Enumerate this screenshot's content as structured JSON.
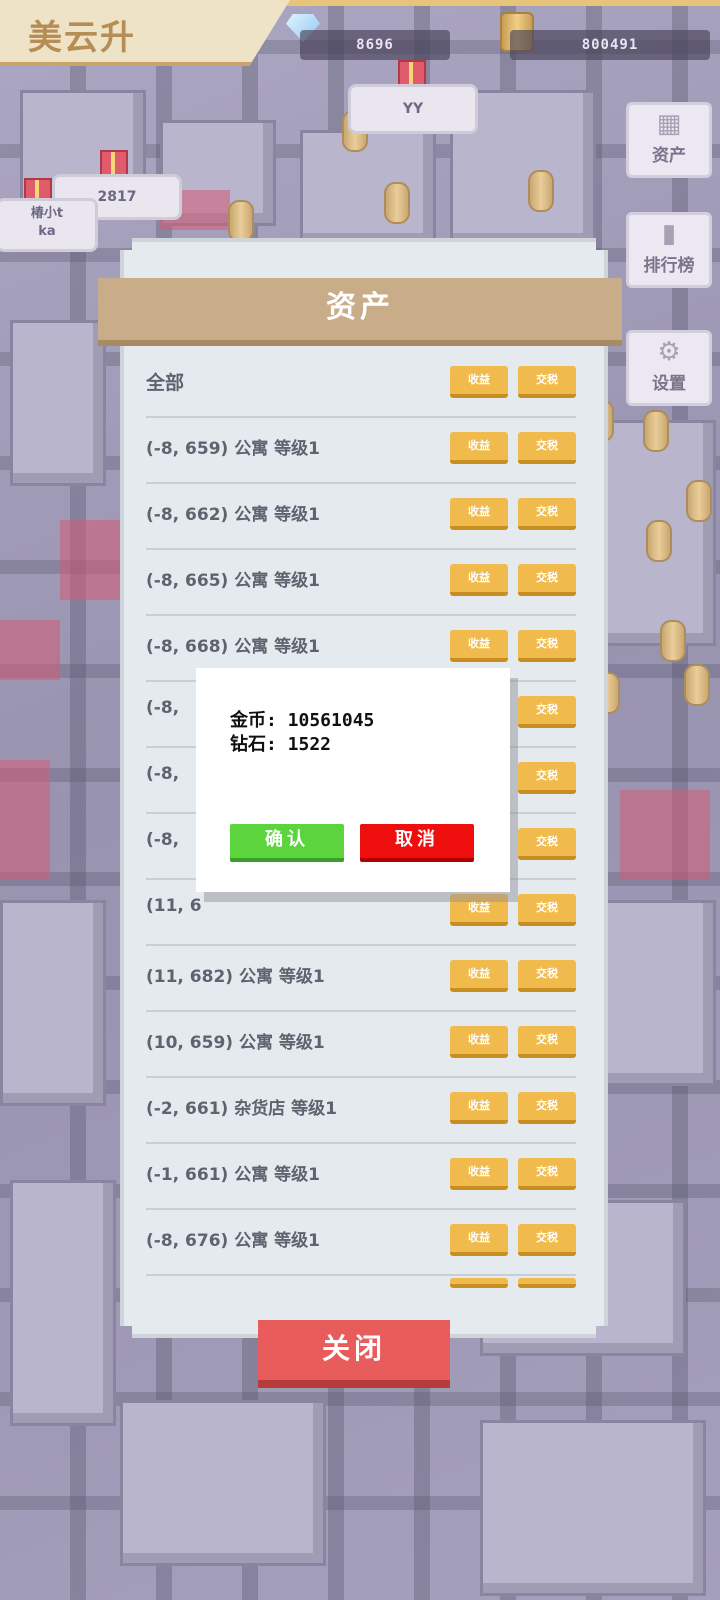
{
  "app": {
    "title": "美云升"
  },
  "resources": {
    "diamonds": "8696",
    "gold": "800491"
  },
  "bubbles": [
    {
      "text": "YY"
    },
    {
      "text": "2817"
    },
    {
      "name": "椿小t",
      "sub": "ka"
    }
  ],
  "side_menu": [
    {
      "label": "资产",
      "icon": "buildings-icon"
    },
    {
      "label": "排行榜",
      "icon": "ranking-icon"
    },
    {
      "label": "设置",
      "icon": "gear-icon"
    }
  ],
  "panel": {
    "title": "资产",
    "income_label": "收益",
    "tax_label": "交税",
    "rows": [
      {
        "label": "全部"
      },
      {
        "label": "(-8, 659) 公寓 等级1"
      },
      {
        "label": "(-8, 662) 公寓 等级1"
      },
      {
        "label": "(-8, 665) 公寓 等级1"
      },
      {
        "label": "(-8, 668) 公寓 等级1"
      },
      {
        "label": "(-8,"
      },
      {
        "label": "(-8,"
      },
      {
        "label": "(-8,"
      },
      {
        "label": "(11, 6"
      },
      {
        "label": "(11, 682) 公寓 等级1"
      },
      {
        "label": "(10, 659) 公寓 等级1"
      },
      {
        "label": "(-2, 661) 杂货店 等级1"
      },
      {
        "label": "(-1, 661) 公寓 等级1"
      },
      {
        "label": "(-8, 676) 公寓 等级1"
      }
    ],
    "close_label": "关闭"
  },
  "dialog": {
    "gold_line": "金币: 10561045",
    "diamond_line": "钻石: 1522",
    "confirm_label": "确认",
    "cancel_label": "取消"
  },
  "colors": {
    "accent_gold": "#f0bb4c",
    "confirm_green": "#5cd43e",
    "cancel_red": "#ee0e0e",
    "close_red": "#e85c5c"
  }
}
